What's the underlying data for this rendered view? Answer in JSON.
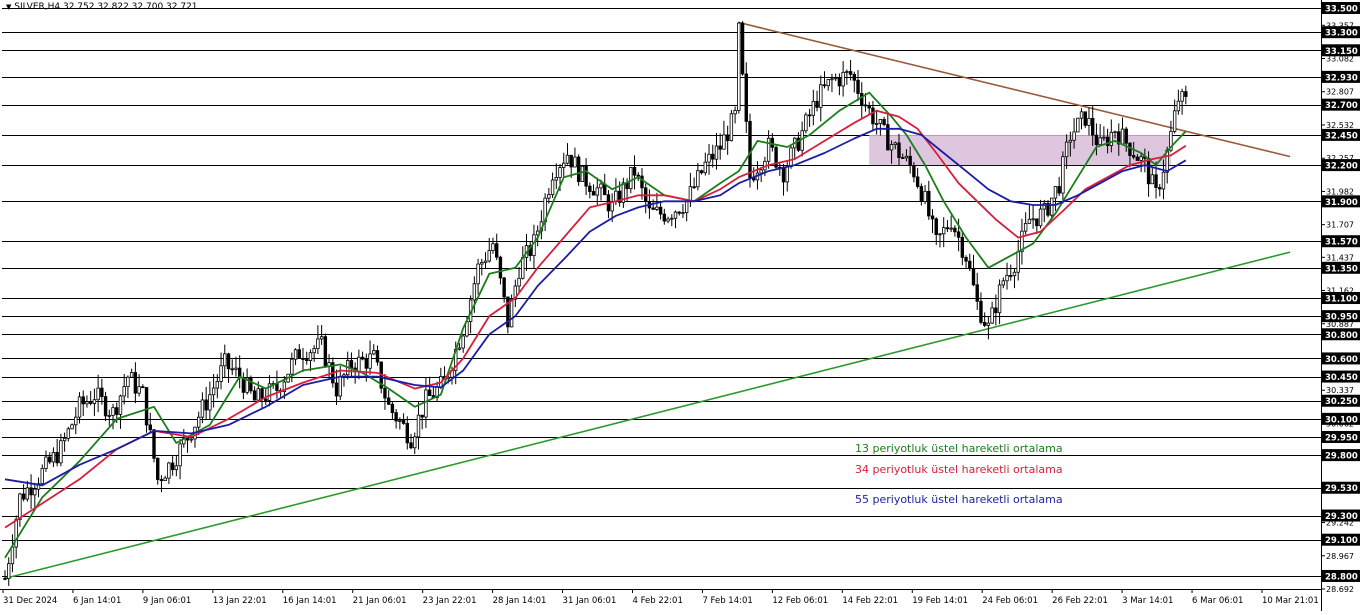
{
  "header": {
    "dropdown_icon": "triangle-down-icon",
    "ohlc": "SILVER,H4  32.752 32.822 32.700 32.721"
  },
  "legend": {
    "ema13": "13 periyotluk üstel hareketli ortalama",
    "ema34": "34 periyotluk üstel hareketli ortalama",
    "ema55": "55 periyotluk üstel hareketli ortalama"
  },
  "colors": {
    "ema13": "#1a7f1a",
    "ema34": "#d81e3a",
    "ema55": "#1c1ca6",
    "resistance_trendline": "#9a5a3a",
    "support_trendline": "#2a9a2a",
    "zone_fill": "#d8bcd8",
    "candle": "#000000",
    "hline": "#000000",
    "current_price_label_bg": "#000000",
    "current_price_label_text": "#ffffff"
  },
  "chart_data": {
    "type": "candlestick",
    "symbol": "SILVER",
    "timeframe": "H4",
    "ylim": [
      28.692,
      33.5
    ],
    "grid": false,
    "y_tick_labels": [
      "33.500",
      "33.357",
      "33.082",
      "32.807",
      "32.532",
      "32.257",
      "31.982",
      "31.707",
      "31.437",
      "31.162",
      "30.887",
      "30.612",
      "30.337",
      "30.062",
      "29.787",
      "29.512",
      "29.242",
      "28.967",
      "28.692"
    ],
    "horizontal_levels": [
      33.5,
      33.3,
      33.15,
      32.93,
      32.7,
      32.45,
      32.2,
      31.9,
      31.57,
      31.35,
      31.1,
      30.95,
      30.8,
      30.6,
      30.45,
      30.25,
      30.1,
      29.95,
      29.8,
      29.53,
      29.3,
      29.1,
      28.8
    ],
    "current_price": 32.7,
    "x_tick_labels": [
      "31 Dec 2024",
      "6 Jan 14:01",
      "9 Jan 06:01",
      "13 Jan 22:01",
      "16 Jan 14:01",
      "21 Jan 06:01",
      "23 Jan 22:01",
      "28 Jan 14:01",
      "31 Jan 06:01",
      "4 Feb 22:01",
      "7 Feb 14:01",
      "12 Feb 06:01",
      "14 Feb 22:01",
      "19 Feb 14:01",
      "24 Feb 06:01",
      "26 Feb 22:01",
      "3 Mar 14:01",
      "6 Mar 06:01",
      "10 Mar 21:01"
    ],
    "price_path": [
      [
        0,
        28.78
      ],
      [
        4,
        29.45
      ],
      [
        9,
        29.62
      ],
      [
        15,
        29.85
      ],
      [
        20,
        30.2
      ],
      [
        24,
        30.3
      ],
      [
        29,
        30.15
      ],
      [
        33,
        30.45
      ],
      [
        37,
        30.3
      ],
      [
        41,
        29.6
      ],
      [
        45,
        29.75
      ],
      [
        49,
        29.95
      ],
      [
        55,
        30.3
      ],
      [
        59,
        30.55
      ],
      [
        63,
        30.45
      ],
      [
        67,
        30.25
      ],
      [
        73,
        30.35
      ],
      [
        79,
        30.65
      ],
      [
        85,
        30.7
      ],
      [
        89,
        30.35
      ],
      [
        93,
        30.55
      ],
      [
        99,
        30.6
      ],
      [
        103,
        30.2
      ],
      [
        109,
        29.95
      ],
      [
        113,
        30.25
      ],
      [
        118,
        30.4
      ],
      [
        123,
        30.85
      ],
      [
        127,
        31.35
      ],
      [
        131,
        31.55
      ],
      [
        135,
        30.9
      ],
      [
        138,
        31.35
      ],
      [
        142,
        31.55
      ],
      [
        147,
        32.15
      ],
      [
        151,
        32.3
      ],
      [
        155,
        32.1
      ],
      [
        159,
        32.0
      ],
      [
        163,
        31.85
      ],
      [
        169,
        32.15
      ],
      [
        173,
        31.8
      ],
      [
        178,
        31.8
      ],
      [
        183,
        31.9
      ],
      [
        188,
        32.2
      ],
      [
        192,
        32.35
      ],
      [
        196,
        32.6
      ],
      [
        197,
        33.3
      ],
      [
        200,
        32.1
      ],
      [
        205,
        32.35
      ],
      [
        209,
        32.15
      ],
      [
        213,
        32.4
      ],
      [
        218,
        32.75
      ],
      [
        222,
        32.9
      ],
      [
        227,
        32.95
      ],
      [
        232,
        32.65
      ],
      [
        236,
        32.45
      ],
      [
        240,
        32.3
      ],
      [
        244,
        32.15
      ],
      [
        247,
        31.9
      ],
      [
        250,
        31.55
      ],
      [
        254,
        31.75
      ],
      [
        258,
        31.45
      ],
      [
        261,
        31.05
      ],
      [
        264,
        30.85
      ],
      [
        268,
        31.25
      ],
      [
        271,
        31.4
      ],
      [
        275,
        31.75
      ],
      [
        279,
        31.8
      ],
      [
        283,
        32.05
      ],
      [
        286,
        32.45
      ],
      [
        290,
        32.6
      ],
      [
        294,
        32.35
      ],
      [
        298,
        32.5
      ],
      [
        302,
        32.35
      ],
      [
        306,
        32.2
      ],
      [
        309,
        31.95
      ],
      [
        312,
        32.3
      ],
      [
        315,
        32.75
      ],
      [
        317,
        32.72
      ]
    ],
    "series": [
      {
        "name": "13 periyotluk üstel hareketli ortalama",
        "values": [
          [
            0,
            28.95
          ],
          [
            10,
            29.45
          ],
          [
            20,
            29.75
          ],
          [
            30,
            30.1
          ],
          [
            40,
            30.2
          ],
          [
            46,
            29.9
          ],
          [
            55,
            30.05
          ],
          [
            63,
            30.45
          ],
          [
            70,
            30.35
          ],
          [
            80,
            30.5
          ],
          [
            90,
            30.55
          ],
          [
            96,
            30.48
          ],
          [
            103,
            30.35
          ],
          [
            110,
            30.2
          ],
          [
            117,
            30.3
          ],
          [
            123,
            30.85
          ],
          [
            130,
            31.3
          ],
          [
            137,
            31.35
          ],
          [
            143,
            31.6
          ],
          [
            150,
            32.1
          ],
          [
            156,
            32.15
          ],
          [
            163,
            32.0
          ],
          [
            170,
            32.1
          ],
          [
            177,
            31.95
          ],
          [
            185,
            31.9
          ],
          [
            192,
            32.05
          ],
          [
            197,
            32.15
          ],
          [
            202,
            32.4
          ],
          [
            210,
            32.35
          ],
          [
            216,
            32.45
          ],
          [
            224,
            32.65
          ],
          [
            232,
            32.8
          ],
          [
            238,
            32.6
          ],
          [
            242,
            32.45
          ],
          [
            247,
            32.2
          ],
          [
            252,
            31.9
          ],
          [
            258,
            31.6
          ],
          [
            264,
            31.35
          ],
          [
            270,
            31.45
          ],
          [
            276,
            31.55
          ],
          [
            282,
            31.8
          ],
          [
            288,
            32.1
          ],
          [
            293,
            32.35
          ],
          [
            298,
            32.4
          ],
          [
            305,
            32.3
          ],
          [
            309,
            32.2
          ],
          [
            313,
            32.35
          ],
          [
            317,
            32.48
          ]
        ]
      },
      {
        "name": "34 periyotluk üstel hareketli ortalama",
        "values": [
          [
            0,
            29.2
          ],
          [
            10,
            29.4
          ],
          [
            20,
            29.6
          ],
          [
            30,
            29.85
          ],
          [
            40,
            30.0
          ],
          [
            50,
            29.95
          ],
          [
            60,
            30.1
          ],
          [
            70,
            30.28
          ],
          [
            80,
            30.4
          ],
          [
            90,
            30.5
          ],
          [
            100,
            30.48
          ],
          [
            110,
            30.35
          ],
          [
            117,
            30.4
          ],
          [
            123,
            30.6
          ],
          [
            130,
            30.95
          ],
          [
            137,
            31.1
          ],
          [
            143,
            31.35
          ],
          [
            150,
            31.6
          ],
          [
            157,
            31.85
          ],
          [
            164,
            31.9
          ],
          [
            170,
            31.95
          ],
          [
            177,
            31.95
          ],
          [
            185,
            31.9
          ],
          [
            192,
            32.0
          ],
          [
            197,
            32.1
          ],
          [
            205,
            32.2
          ],
          [
            212,
            32.25
          ],
          [
            220,
            32.4
          ],
          [
            228,
            32.55
          ],
          [
            234,
            32.65
          ],
          [
            240,
            32.6
          ],
          [
            245,
            32.5
          ],
          [
            250,
            32.3
          ],
          [
            256,
            32.05
          ],
          [
            261,
            31.9
          ],
          [
            266,
            31.75
          ],
          [
            272,
            31.6
          ],
          [
            278,
            31.65
          ],
          [
            284,
            31.82
          ],
          [
            290,
            32.0
          ],
          [
            296,
            32.1
          ],
          [
            302,
            32.2
          ],
          [
            308,
            32.25
          ],
          [
            313,
            32.28
          ],
          [
            317,
            32.36
          ]
        ]
      },
      {
        "name": "55 periyotluk üstel hareketli ortalama",
        "values": [
          [
            0,
            29.6
          ],
          [
            10,
            29.55
          ],
          [
            20,
            29.72
          ],
          [
            30,
            29.85
          ],
          [
            40,
            30.0
          ],
          [
            50,
            29.98
          ],
          [
            60,
            30.05
          ],
          [
            70,
            30.2
          ],
          [
            80,
            30.38
          ],
          [
            90,
            30.45
          ],
          [
            100,
            30.45
          ],
          [
            110,
            30.38
          ],
          [
            117,
            30.36
          ],
          [
            123,
            30.5
          ],
          [
            130,
            30.8
          ],
          [
            137,
            30.95
          ],
          [
            143,
            31.2
          ],
          [
            150,
            31.42
          ],
          [
            157,
            31.65
          ],
          [
            164,
            31.78
          ],
          [
            170,
            31.85
          ],
          [
            177,
            31.9
          ],
          [
            185,
            31.9
          ],
          [
            192,
            31.95
          ],
          [
            197,
            32.05
          ],
          [
            205,
            32.15
          ],
          [
            212,
            32.2
          ],
          [
            220,
            32.3
          ],
          [
            228,
            32.42
          ],
          [
            234,
            32.5
          ],
          [
            240,
            32.5
          ],
          [
            246,
            32.45
          ],
          [
            252,
            32.3
          ],
          [
            258,
            32.15
          ],
          [
            264,
            32.0
          ],
          [
            270,
            31.9
          ],
          [
            276,
            31.87
          ],
          [
            282,
            31.87
          ],
          [
            288,
            31.95
          ],
          [
            294,
            32.05
          ],
          [
            300,
            32.15
          ],
          [
            306,
            32.2
          ],
          [
            312,
            32.15
          ],
          [
            317,
            32.24
          ]
        ]
      }
    ],
    "trendlines": [
      {
        "name": "resistance",
        "from": [
          197,
          33.38
        ],
        "to": [
          345,
          32.27
        ]
      },
      {
        "name": "support",
        "from": [
          0,
          28.78
        ],
        "to": [
          345,
          31.48
        ]
      }
    ],
    "zone": {
      "x_from": 232,
      "x_to": 313,
      "y_from": 32.2,
      "y_to": 32.45
    }
  }
}
